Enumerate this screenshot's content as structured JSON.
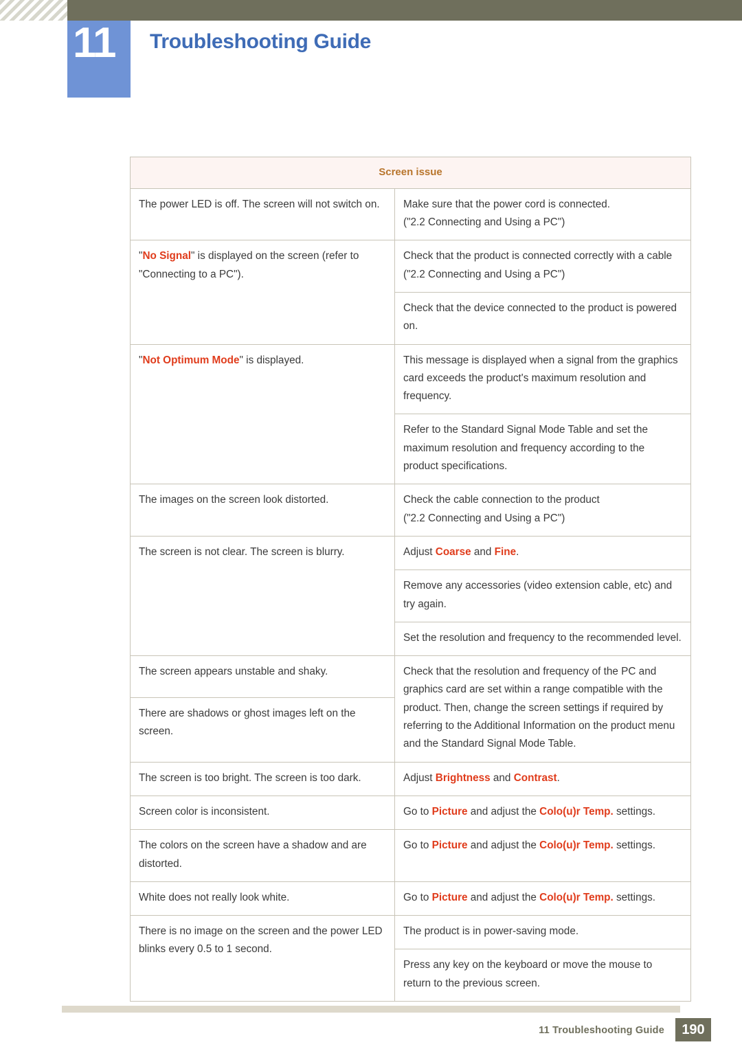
{
  "header": {
    "chapter_number": "11",
    "chapter_title": "Troubleshooting Guide"
  },
  "table": {
    "header_label": "Screen issue",
    "rows": [
      {
        "problem": "The power LED is off. The screen will not switch on.",
        "solution_lines": [
          "Make sure that the power cord is connected.",
          "(\"2.2 Connecting and Using a PC\")"
        ]
      },
      {
        "problem_pre": "\"",
        "problem_hl": "No Signal",
        "problem_post": "\" is displayed on the screen (refer to \"Connecting to a PC\").",
        "solution_lines": [
          "Check that the product is connected correctly with a cable",
          "(\"2.2 Connecting and Using a PC\")"
        ],
        "solution2_lines": [
          "Check that the device connected to the product is powered on."
        ]
      },
      {
        "problem_pre": "\"",
        "problem_hl": "Not Optimum Mode",
        "problem_post": "\" is displayed.",
        "solution_lines": [
          "This message is displayed when a signal from the graphics card exceeds the product's maximum resolution and frequency."
        ],
        "solution2_lines": [
          "Refer to the Standard Signal Mode Table and set the maximum resolution and frequency according to the product specifications."
        ]
      },
      {
        "problem": "The images on the screen look distorted.",
        "solution_lines": [
          "Check the cable connection to the product",
          "(\"2.2 Connecting and Using a PC\")"
        ]
      },
      {
        "problem": "The screen is not clear. The screen is blurry.",
        "solution_adjust_pre": "Adjust ",
        "solution_adjust_a": "Coarse",
        "solution_adjust_mid": " and ",
        "solution_adjust_b": "Fine",
        "solution_adjust_post": ".",
        "solution2_lines": [
          "Remove any accessories (video extension cable, etc) and try again."
        ],
        "solution3_lines": [
          "Set the resolution and frequency to the recommended level."
        ]
      },
      {
        "problem": "The screen appears unstable and shaky.",
        "problem2": "There are shadows or ghost images left on the screen.",
        "solution_lines": [
          "Check that the resolution and frequency of the PC and graphics card are set within a range compatible with the product. Then, change the screen settings if required by referring to the Additional Information on the product menu and the Standard Signal Mode Table."
        ]
      },
      {
        "problem": "The screen is too bright. The screen is too dark.",
        "solution_adjust_pre": "Adjust ",
        "solution_adjust_a": "Brightness",
        "solution_adjust_mid": " and ",
        "solution_adjust_b": "Contrast",
        "solution_adjust_post": "."
      },
      {
        "problem": "Screen color is inconsistent.",
        "goto_pre": "Go to ",
        "goto_a": "Picture",
        "goto_mid": " and adjust the ",
        "goto_b": "Colo(u)r Temp.",
        "goto_post": " settings."
      },
      {
        "problem": "The colors on the screen have a shadow and are distorted.",
        "goto_pre": "Go to ",
        "goto_a": "Picture",
        "goto_mid": " and adjust the ",
        "goto_b": "Colo(u)r Temp.",
        "goto_post": " settings."
      },
      {
        "problem": "White does not really look white.",
        "goto_pre": "Go to ",
        "goto_a": "Picture",
        "goto_mid": " and adjust the ",
        "goto_b": "Colo(u)r Temp.",
        "goto_post": " settings."
      },
      {
        "problem": "There is no image on the screen and the power LED blinks every 0.5 to 1 second.",
        "solution_lines": [
          "The product is in power-saving mode."
        ],
        "solution2_lines": [
          "Press any key on the keyboard or move the mouse to return to the previous screen."
        ]
      }
    ]
  },
  "footer": {
    "text": "11 Troubleshooting Guide",
    "page": "190"
  },
  "colors": {
    "header_bar": "#6f6f5c",
    "badge": "#6f93d6",
    "title": "#3f6cb6",
    "highlight": "#e03c1c",
    "table_header_text": "#b8752c",
    "table_header_bg": "#fdf4f2"
  }
}
